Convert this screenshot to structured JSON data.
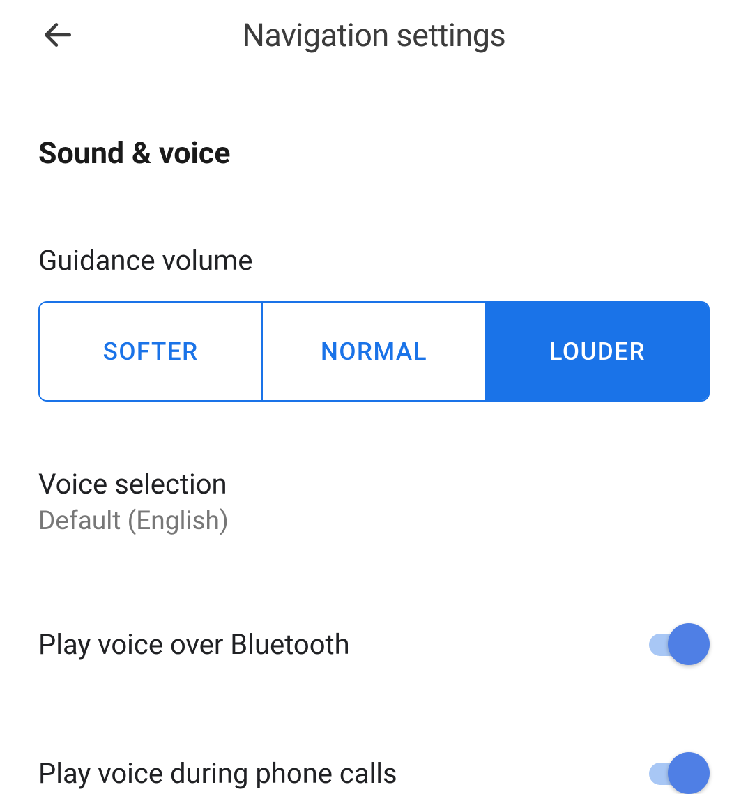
{
  "header": {
    "title": "Navigation settings"
  },
  "section": {
    "heading": "Sound & voice"
  },
  "guidance": {
    "label": "Guidance volume",
    "options": {
      "softer": "SOFTER",
      "normal": "NORMAL",
      "louder": "LOUDER"
    },
    "selected": "louder"
  },
  "voice_selection": {
    "title": "Voice selection",
    "subtitle": "Default (English)"
  },
  "toggles": {
    "bluetooth": {
      "label": "Play voice over Bluetooth",
      "state": true
    },
    "phone_calls": {
      "label": "Play voice during phone calls",
      "state": true
    }
  },
  "colors": {
    "accent": "#1a73e8",
    "switch_thumb": "#4f7fe5",
    "switch_track": "#a8c7f5"
  }
}
